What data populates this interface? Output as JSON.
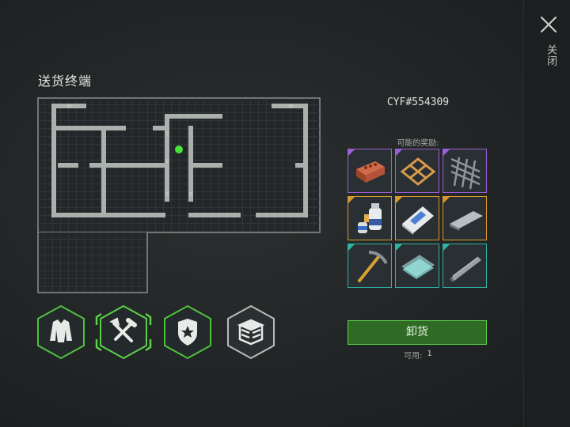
{
  "title": "送货终端",
  "close": {
    "label": "关闭",
    "icon": "close-icon"
  },
  "delivery_code": "CYF#554309",
  "rewards": {
    "label": "可能的奖励:",
    "items": [
      {
        "name": "brick",
        "icon": "brick-icon",
        "rarity": "purple"
      },
      {
        "name": "wooden frame",
        "icon": "wooden-frame-icon",
        "rarity": "purple"
      },
      {
        "name": "metal rebar grid",
        "icon": "rebar-grid-icon",
        "rarity": "purple"
      },
      {
        "name": "chemicals",
        "icon": "chemicals-icon",
        "rarity": "orange"
      },
      {
        "name": "cement bag",
        "icon": "cement-bag-icon",
        "rarity": "orange"
      },
      {
        "name": "steel plate",
        "icon": "steel-plate-icon",
        "rarity": "orange"
      },
      {
        "name": "pickaxe",
        "icon": "pickaxe-icon",
        "rarity": "teal"
      },
      {
        "name": "glass panes",
        "icon": "glass-panes-icon",
        "rarity": "teal"
      },
      {
        "name": "steel beam",
        "icon": "steel-beam-icon",
        "rarity": "teal"
      }
    ]
  },
  "unload": {
    "label": "卸货",
    "available_label": "可用:",
    "available_value": "1"
  },
  "categories": [
    {
      "name": "clothing",
      "icon": "jacket-icon",
      "selected": false
    },
    {
      "name": "tools",
      "icon": "tools-icon",
      "selected": true
    },
    {
      "name": "police",
      "icon": "police-badge-icon",
      "selected": false
    },
    {
      "name": "supplies",
      "icon": "supply-crate-icon",
      "selected": false
    }
  ],
  "colors": {
    "purple": "#9b5fd6",
    "orange": "#d79a2a",
    "teal": "#2fb3a6",
    "green_accent": "#5bd14a",
    "player_marker": "#44e63a"
  }
}
